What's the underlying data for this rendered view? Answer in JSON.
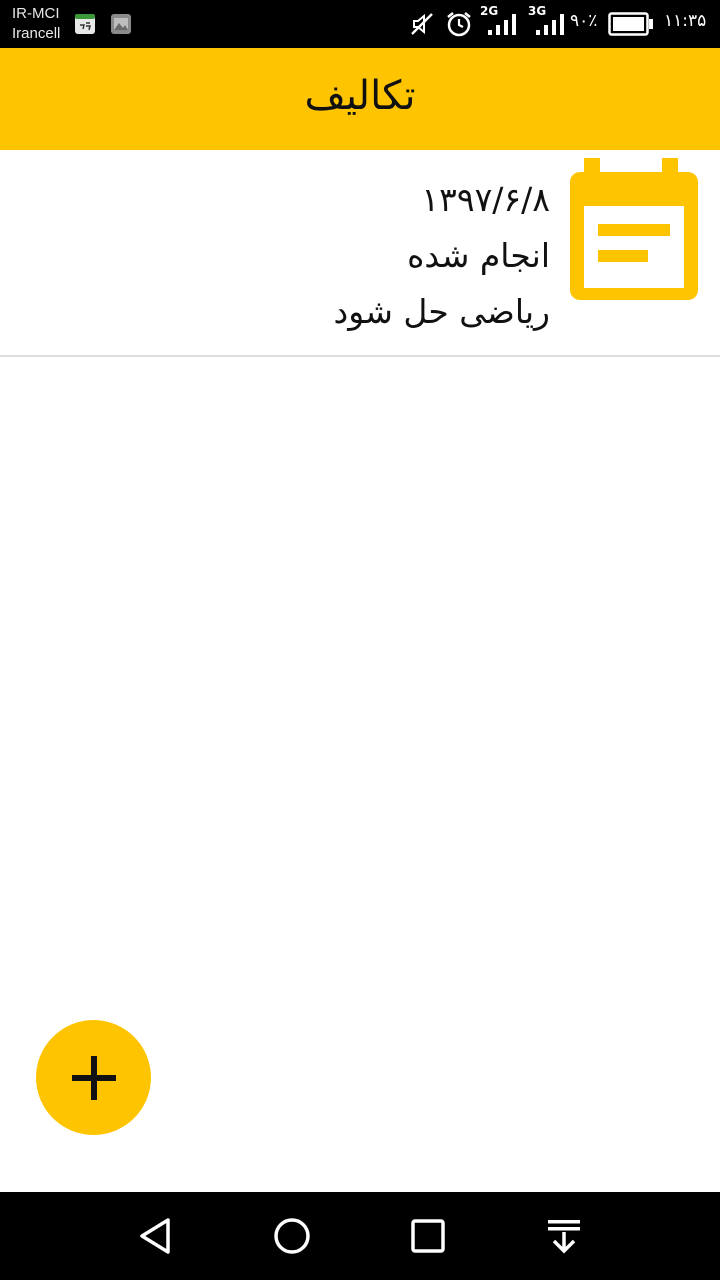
{
  "status_bar": {
    "carrier_1": "IR-MCI",
    "carrier_2": "Irancell",
    "network_1": "2G",
    "network_2": "3G",
    "battery_percent": "۹۰٪",
    "time": "۱۱:۳۵"
  },
  "app_bar": {
    "title": "تکالیف"
  },
  "list": {
    "items": [
      {
        "icon": "calendar-note-icon",
        "date": "۱۳۹۷/۶/۸",
        "status": "انجام شده",
        "title": "ریاضی حل شود"
      }
    ]
  },
  "fab": {
    "icon": "plus-icon"
  },
  "nav_bar": {
    "back_icon": "back-triangle-icon",
    "home_icon": "home-circle-icon",
    "recents_icon": "recents-square-icon",
    "notifications_icon": "pull-down-icon"
  },
  "colors": {
    "accent": "#ffc400",
    "status_bar": "#000000",
    "nav_bar": "#000000",
    "text": "#111111",
    "divider": "#dddddd"
  }
}
